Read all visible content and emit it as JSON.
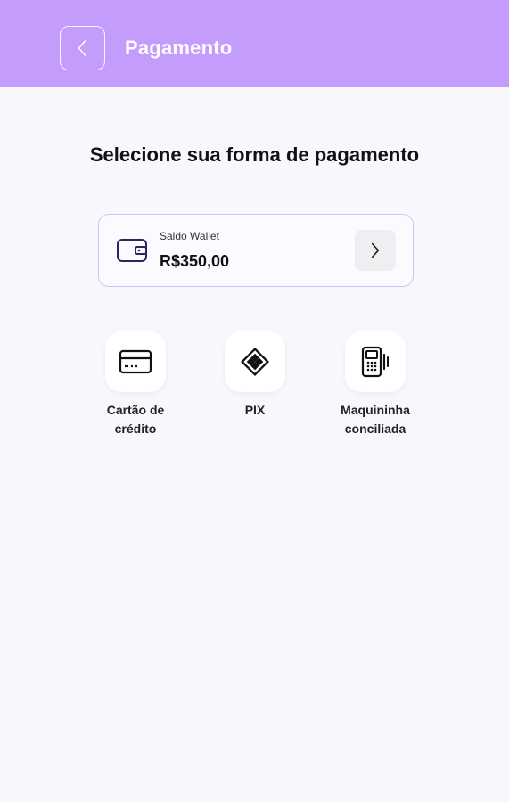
{
  "header": {
    "title": "Pagamento",
    "back_icon": "chevron-left-icon",
    "color": "#c49cfb"
  },
  "main": {
    "heading": "Selecione sua forma de pagamento"
  },
  "wallet": {
    "label": "Saldo Wallet",
    "amount": "R$350,00",
    "icon": "wallet-icon",
    "arrow_icon": "chevron-right-icon"
  },
  "methods": [
    {
      "line1": "Cartão de",
      "line2": "crédito",
      "icon": "credit-card-icon"
    },
    {
      "line1": "PIX",
      "line2": "",
      "icon": "pix-icon"
    },
    {
      "line1": "Maquininha",
      "line2": "conciliada",
      "icon": "card-machine-icon"
    }
  ]
}
